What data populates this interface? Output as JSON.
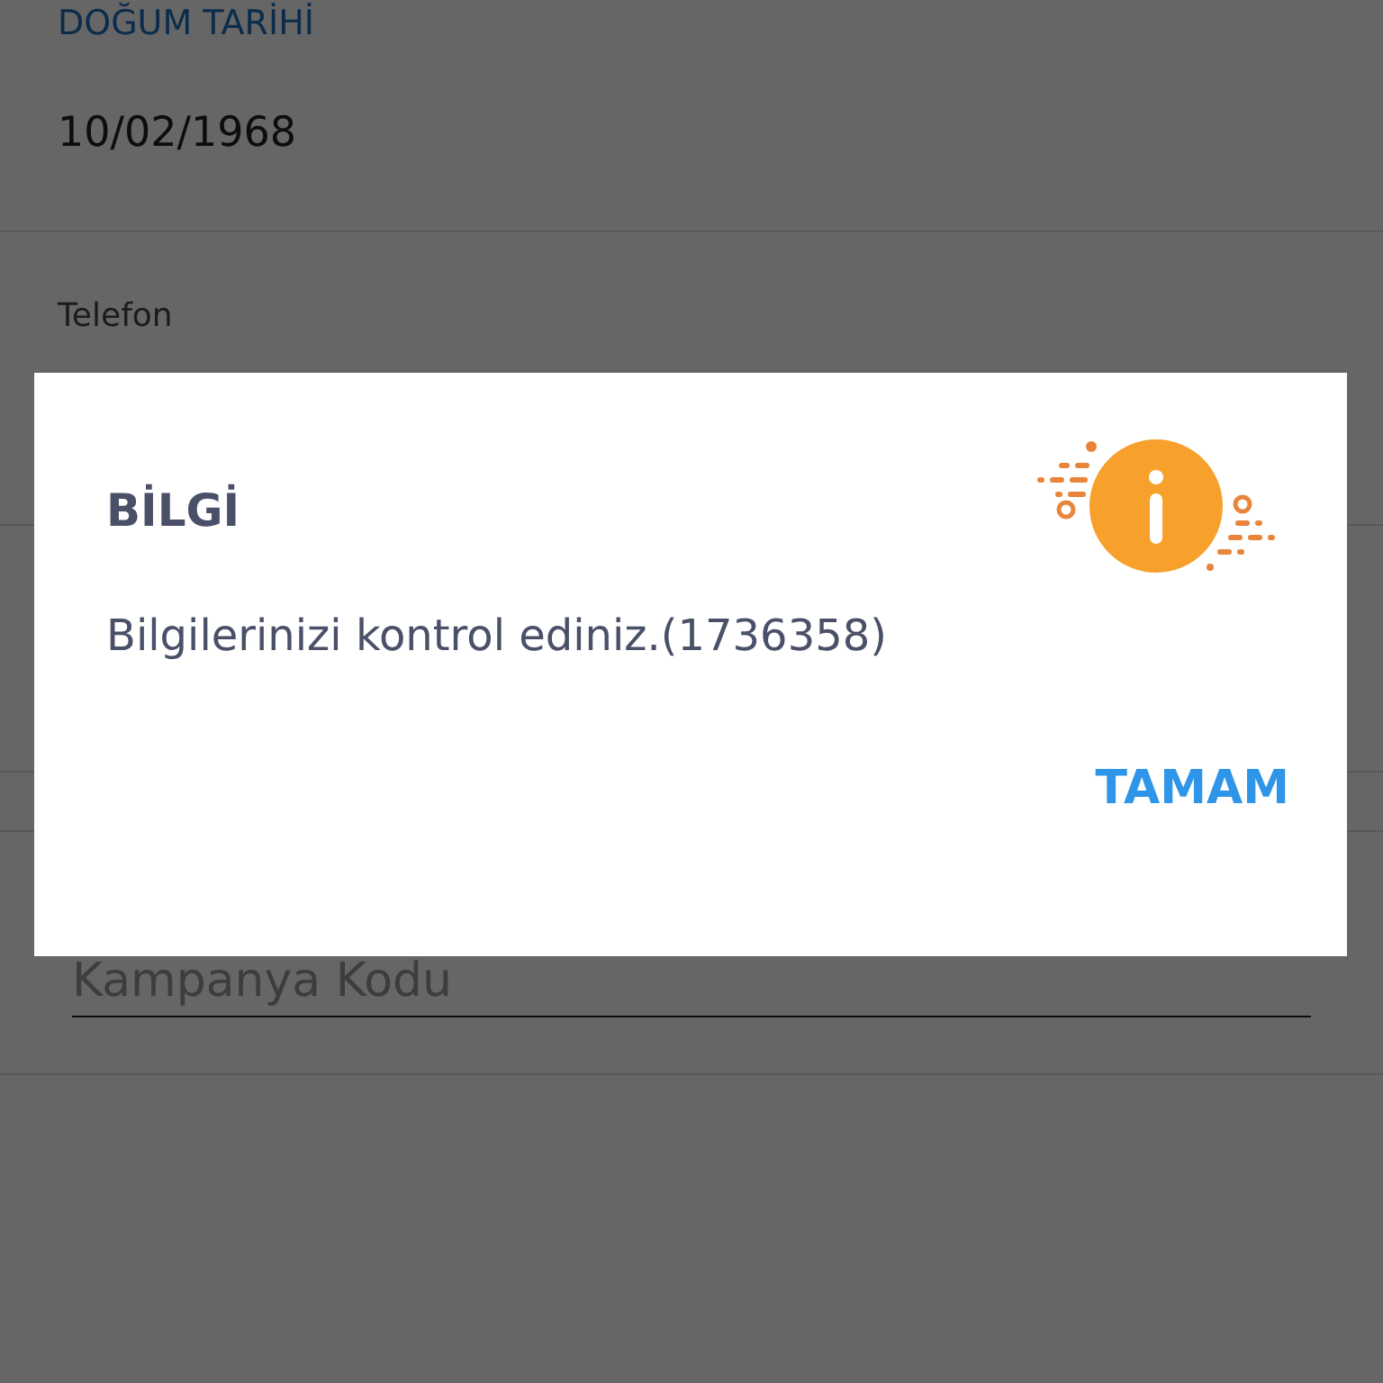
{
  "form": {
    "birth_date_label": "DOĞUM TARİHİ",
    "birth_date": "10/02/1968",
    "phone_label": "Telefon",
    "campaign_code": {
      "placeholder": "Kampanya Kodu"
    }
  },
  "dialog": {
    "title": "BİLGİ",
    "message": "Bilgilerinizi kontrol ediniz.(1736358)",
    "button": "TAMAM"
  }
}
